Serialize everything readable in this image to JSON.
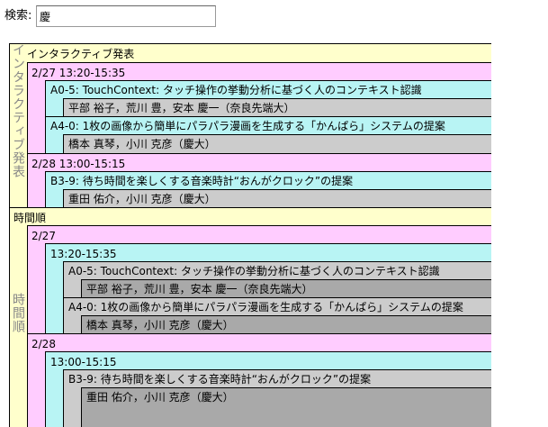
{
  "search": {
    "label": "検索:",
    "value": "慶"
  },
  "sections": {
    "interactive": {
      "header": "インタラクティブ発表",
      "side_label": "インタラクティブ発表",
      "dates": [
        {
          "label": "2/27 13:20-15:35",
          "papers": [
            {
              "title": "A0-5: TouchContext: タッチ操作の挙動分析に基づく人のコンテキスト認識",
              "authors": "平部 裕子，荒川 豊，安本 慶一（奈良先端大）"
            },
            {
              "title": "A4-0: 1枚の画像から簡単にパラパラ漫画を生成する「かんぱら」システムの提案",
              "authors": "橋本 真琴，小川 克彦（慶大）"
            }
          ]
        },
        {
          "label": "2/28 13:00-15:15",
          "papers": [
            {
              "title": "B3-9: 待ち時間を楽しくする音楽時計“おんがクロック”の提案",
              "authors": "重田 佑介，小川 克彦（慶大）"
            }
          ]
        }
      ]
    },
    "chrono": {
      "header": "時間順",
      "side_label": "時間順",
      "days": [
        {
          "label": "2/27",
          "slots": [
            {
              "label": "13:20-15:35",
              "papers": [
                {
                  "title": "A0-5: TouchContext: タッチ操作の挙動分析に基づく人のコンテキスト認識",
                  "authors": "平部 裕子，荒川 豊，安本 慶一（奈良先端大）"
                },
                {
                  "title": "A4-0: 1枚の画像から簡単にパラパラ漫画を生成する「かんぱら」システムの提案",
                  "authors": "橋本 真琴，小川 克彦（慶大）"
                }
              ]
            }
          ]
        },
        {
          "label": "2/28",
          "slots": [
            {
              "label": "13:00-15:15",
              "papers": [
                {
                  "title": "B3-9: 待ち時間を楽しくする音楽時計“おんがクロック”の提案",
                  "authors": "重田 佑介，小川 克彦（慶大）"
                }
              ]
            }
          ]
        }
      ]
    }
  },
  "colors": {
    "section_bg": "#ffffcc",
    "date_bg": "#ffccff",
    "session_bg": "#b8f4f4",
    "paper_bg": "#cccccc",
    "author_bg": "#a9a9a9",
    "side_label": "#888888"
  }
}
